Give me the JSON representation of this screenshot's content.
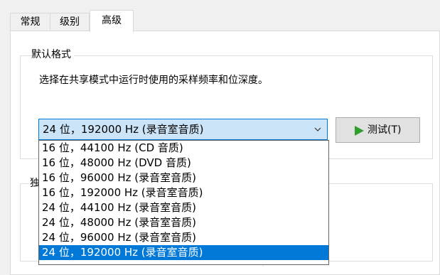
{
  "tabs": [
    {
      "label": "常规"
    },
    {
      "label": "级别"
    },
    {
      "label": "高级"
    }
  ],
  "default_format": {
    "title": "默认格式",
    "description": "选择在共享模式中运行时使用的采样频率和位深度。",
    "selected_value": "24 位，192000 Hz (录音室音质)",
    "test_button_label": "测试(T)"
  },
  "exclusive_group": {
    "title_partial": "独"
  },
  "dropdown": {
    "options": [
      "16 位，44100 Hz (CD 音质)",
      "16 位，48000 Hz (DVD 音质)",
      "16 位，96000 Hz (录音室音质)",
      "16 位，192000 Hz (录音室音质)",
      "24 位，44100 Hz (录音室音质)",
      "24 位，48000 Hz (录音室音质)",
      "24 位，96000 Hz (录音室音质)",
      "24 位，192000 Hz (录音室音质)"
    ],
    "selected_index": 7
  },
  "colors": {
    "accent": "#0078d7",
    "play_icon": "#2e9e2e"
  },
  "icons": {
    "combo_arrow": "chevron-down-icon",
    "test": "play-icon"
  }
}
